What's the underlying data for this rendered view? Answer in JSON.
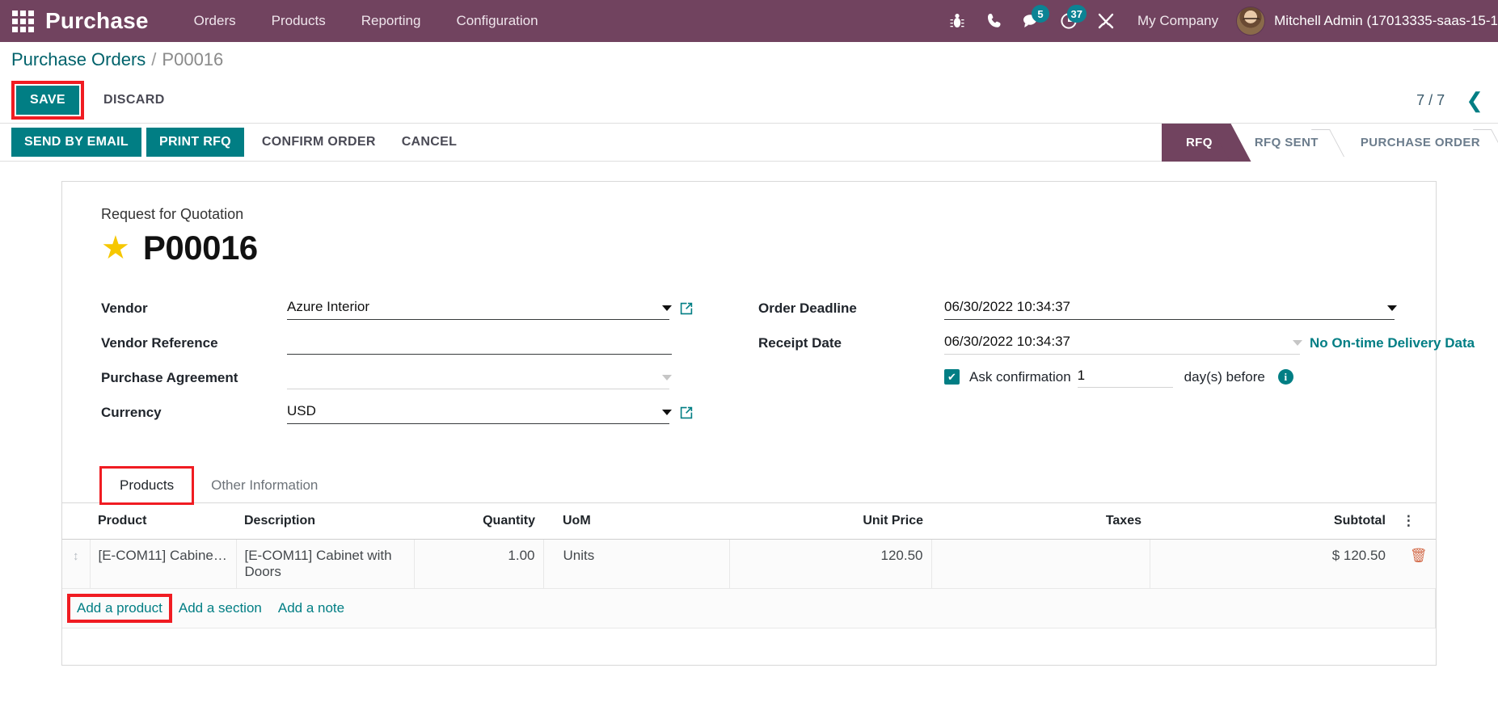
{
  "navbar": {
    "apps_icon": "apps-grid-icon",
    "brand": "Purchase",
    "menu": [
      {
        "label": "Orders"
      },
      {
        "label": "Products"
      },
      {
        "label": "Reporting"
      },
      {
        "label": "Configuration"
      }
    ],
    "sys_icons": [
      {
        "name": "bug-icon",
        "badge": ""
      },
      {
        "name": "phone-icon",
        "badge": ""
      },
      {
        "name": "messages-icon",
        "badge": "5"
      },
      {
        "name": "activities-clock-icon",
        "badge": "37"
      },
      {
        "name": "tools-icon",
        "badge": ""
      }
    ],
    "company": "My Company",
    "user": "Mitchell Admin (17013335-saas-15-1"
  },
  "breadcrumb": {
    "root": "Purchase Orders",
    "separator": "/",
    "current": "P00016"
  },
  "controls": {
    "save_label": "SAVE",
    "discard_label": "DISCARD",
    "pager": "7 / 7",
    "pager_prev_icon": "chevron-left-icon"
  },
  "actions": {
    "buttons": [
      {
        "label": "SEND BY EMAIL",
        "primary": true
      },
      {
        "label": "PRINT RFQ",
        "primary": true
      },
      {
        "label": "CONFIRM ORDER",
        "primary": false
      },
      {
        "label": "CANCEL",
        "primary": false
      }
    ]
  },
  "statusbar": {
    "stages": [
      {
        "label": "RFQ",
        "active": true
      },
      {
        "label": "RFQ SENT",
        "active": false
      },
      {
        "label": "PURCHASE ORDER",
        "active": false
      }
    ]
  },
  "form": {
    "subtitle": "Request for Quotation",
    "star_icon": "star-icon",
    "title": "P00016",
    "left_fields": [
      {
        "label": "Vendor",
        "value": "Azure Interior",
        "has_caret": true,
        "has_ext": true,
        "underline": "dark"
      },
      {
        "label": "Vendor Reference",
        "value": "",
        "has_caret": false,
        "has_ext": false,
        "underline": "dark"
      },
      {
        "label": "Purchase Agreement",
        "value": "",
        "has_caret": true,
        "has_ext": false,
        "underline": "light"
      },
      {
        "label": "Currency",
        "value": "USD",
        "has_caret": true,
        "has_ext": true,
        "underline": "dark"
      }
    ],
    "right_fields": [
      {
        "label": "Order Deadline",
        "value": "06/30/2022 10:34:37",
        "has_caret": true,
        "underline": "dark"
      },
      {
        "label": "Receipt Date",
        "value": "06/30/2022 10:34:37",
        "has_caret": true,
        "underline": "light"
      }
    ],
    "delivery_link": "No On-time Delivery Data",
    "ask_confirmation": {
      "label": "Ask confirmation",
      "days": "1",
      "suffix": "day(s) before",
      "checked": true,
      "info_icon": "info-icon"
    }
  },
  "notebook": {
    "tabs": [
      {
        "label": "Products",
        "active": true,
        "highlighted": true
      },
      {
        "label": "Other Information",
        "active": false,
        "highlighted": false
      }
    ],
    "columns": [
      "Product",
      "Description",
      "Quantity",
      "UoM",
      "Unit Price",
      "Taxes",
      "Subtotal"
    ],
    "options_icon": "column-options-icon",
    "rows": [
      {
        "handle_icon": "drag-handle-icon",
        "product": "[E-COM11] Cabinet ...",
        "description": "[E-COM11] Cabinet with Doors",
        "quantity": "1.00",
        "uom": "Units",
        "unit_price": "120.50",
        "taxes": "",
        "subtotal": "$ 120.50",
        "delete_icon": "trash-icon"
      }
    ],
    "add_links": [
      {
        "label": "Add a product",
        "highlighted": true
      },
      {
        "label": "Add a section",
        "highlighted": false
      },
      {
        "label": "Add a note",
        "highlighted": false
      }
    ]
  },
  "colors": {
    "brand_purple": "#71435f",
    "teal": "#017e84",
    "badge_teal": "#0c8394",
    "highlight_red": "#f01c22",
    "star_yellow": "#f6c700"
  }
}
